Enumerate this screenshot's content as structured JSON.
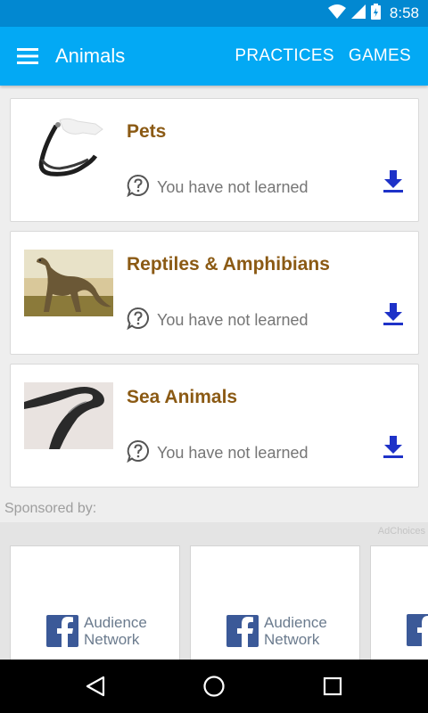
{
  "status_bar": {
    "time": "8:58"
  },
  "app_bar": {
    "title": "Animals",
    "actions": [
      "PRACTICES",
      "GAMES"
    ]
  },
  "topics": [
    {
      "title": "Pets",
      "status": "You have not learned"
    },
    {
      "title": "Reptiles & Amphibians",
      "status": "You have not learned"
    },
    {
      "title": "Sea Animals",
      "status": "You have not learned"
    }
  ],
  "sponsored": {
    "label": "Sponsored by:",
    "adchoices": "AdChoices",
    "ads": [
      {
        "line1": "Audience",
        "line2": "Network"
      },
      {
        "line1": "Audience",
        "line2": "Network"
      }
    ]
  },
  "colors": {
    "primary": "#03a9f4",
    "primary_dark": "#0288d1",
    "title": "#8b5a14",
    "download": "#1e32c8"
  }
}
